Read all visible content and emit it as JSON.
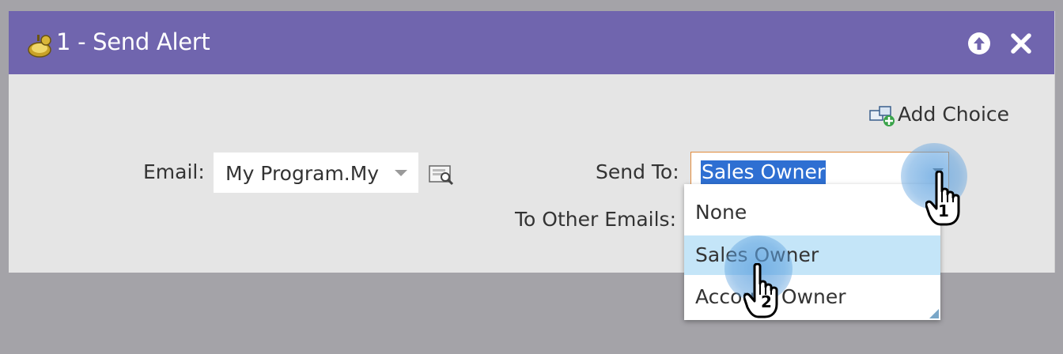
{
  "dialog": {
    "title": "1 - Send Alert",
    "title_icon": "flow-step-icon",
    "collapse_icon": "arrow-up-circle-icon",
    "close_icon": "close-icon"
  },
  "add_choice": {
    "label": "Add Choice",
    "icon": "add-choice-icon"
  },
  "form": {
    "email_label": "Email:",
    "email_value": "My Program.My",
    "preview_icon": "email-preview-icon",
    "send_to_label": "Send To:",
    "send_to_value": "Sales Owner",
    "other_emails_label": "To Other Emails:"
  },
  "dropdown": {
    "options": [
      "None",
      "Sales Owner",
      "Account Owner"
    ],
    "selected": "Sales Owner"
  },
  "callouts": {
    "step1": "1",
    "step2": "2"
  },
  "colors": {
    "titlebar": "#7065ae",
    "panel": "#e5e5e5",
    "selection": "#2e6fd2",
    "hover_option": "#c4e5f8",
    "focus_border": "#e08a3c"
  }
}
